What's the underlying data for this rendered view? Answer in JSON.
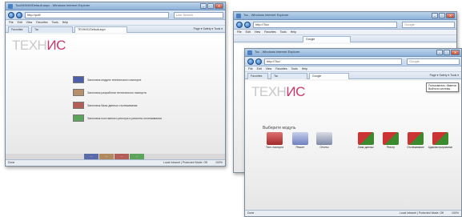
{
  "win1": {
    "title": "Ткс/ИИ/ИИ/Default.aspx - Windows Internet Explorer",
    "address": "http://pdf/",
    "search": "Live Search",
    "menu": [
      "File",
      "Edit",
      "View",
      "Favorites",
      "Tools",
      "Help"
    ],
    "tabs": [
      "Favorites",
      "Ткс",
      "ТЕХНИС/Default.aspx"
    ],
    "tab_tools": "Page ▾  Safety ▾  Tools ▾",
    "logo_a": "ТЕХН",
    "logo_b": "ИС",
    "items": [
      {
        "label": "Заголовок модуля технического паспорта"
      },
      {
        "label": "Заголовок разработки технического паспорта"
      },
      {
        "label": "Заголовок базы данных отслеживания"
      },
      {
        "label": "Заголовок постоянного реестра и ремонта отслеживания"
      }
    ],
    "footer_buttons": [
      "—",
      "—",
      "—",
      "—"
    ],
    "status_left": "Done",
    "status_right": "Local intranet | Protected Mode: Off",
    "zoom": "100%",
    "colors": {
      "item1": "#4d5fa8",
      "item2": "#b5906a",
      "item3": "#b45c58",
      "item4": "#5ca35b"
    }
  },
  "win2": {
    "title": "Ткс - Windows Internet Explorer",
    "address": "http://Ткс/",
    "search": "Google",
    "menu": [
      "File",
      "Edit",
      "View",
      "Favorites",
      "Tools",
      "Help"
    ],
    "tab": "Google"
  },
  "win3": {
    "title": "Ткс - Windows Internet Explorer",
    "address": "http://Ткс/",
    "search": "Google",
    "menu": [
      "File",
      "Edit",
      "View",
      "Favorites",
      "Tools",
      "Help"
    ],
    "tabs": [
      "Favorites",
      "Ткс",
      "Google"
    ],
    "tab_tools": "Page ▾  Safety ▾  Tools ▾",
    "logo_a": "ТЕХН",
    "logo_b": "ИС",
    "tooltip_line1": "Пользователь: Ивантов",
    "tooltip_line2": "Выйти из системы",
    "section_title": "Выберите модуль",
    "icons_left": [
      {
        "label": "Техн. паспорта",
        "color": "#c44a4a"
      },
      {
        "label": "Ремонт",
        "color": "#6d7fbf"
      },
      {
        "label": "Отчеты",
        "color": "#7e8aa6"
      }
    ],
    "icons_right": [
      {
        "label": "Базы данных",
        "color": "#4e8f3a"
      },
      {
        "label": "Реестр",
        "color": "#4e8f3a"
      },
      {
        "label": "Отслеживание",
        "color": "#4e8f3a"
      },
      {
        "label": "Администрирование",
        "color": "#4e8f3a"
      }
    ],
    "status_left": "Done",
    "status_right": "Local intranet | Protected Mode: Off",
    "zoom": "100%"
  }
}
